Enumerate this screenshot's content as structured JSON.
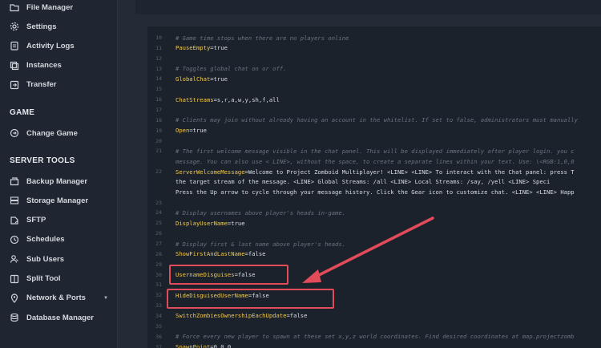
{
  "sidebar": {
    "items_top": [
      {
        "label": "File Manager",
        "icon": "folder-icon"
      },
      {
        "label": "Settings",
        "icon": "gear-icon"
      },
      {
        "label": "Activity Logs",
        "icon": "clipboard-icon"
      },
      {
        "label": "Instances",
        "icon": "layers-icon"
      },
      {
        "label": "Transfer",
        "icon": "transfer-icon"
      }
    ],
    "game_section": "GAME",
    "game_items": [
      {
        "label": "Change Game",
        "icon": "swap-icon"
      }
    ],
    "server_tools_section": "SERVER TOOLS",
    "server_items": [
      {
        "label": "Backup Manager",
        "icon": "backup-icon"
      },
      {
        "label": "Storage Manager",
        "icon": "storage-icon"
      },
      {
        "label": "SFTP",
        "icon": "sftp-icon"
      },
      {
        "label": "Schedules",
        "icon": "clock-icon"
      },
      {
        "label": "Sub Users",
        "icon": "users-icon"
      },
      {
        "label": "Split Tool",
        "icon": "split-icon"
      },
      {
        "label": "Network & Ports",
        "icon": "location-icon"
      },
      {
        "label": "Database Manager",
        "icon": "database-icon"
      }
    ]
  },
  "editor": {
    "lines": [
      {
        "n": "10",
        "type": "comment",
        "text": "# Game time stops when there are no players online"
      },
      {
        "n": "11",
        "type": "kv",
        "key": "PauseEmpty",
        "value": "=true"
      },
      {
        "n": "12",
        "type": "blank"
      },
      {
        "n": "13",
        "type": "comment",
        "text": "# Toggles global chat on or off."
      },
      {
        "n": "14",
        "type": "kv",
        "key": "GlobalChat",
        "value": "=true"
      },
      {
        "n": "15",
        "type": "blank"
      },
      {
        "n": "16",
        "type": "kv",
        "key": "ChatStreams",
        "value": "=s,r,a,w,y,sh,f,all"
      },
      {
        "n": "17",
        "type": "blank"
      },
      {
        "n": "18",
        "type": "comment",
        "text": "# Clients may join without already having an account in the whitelist. If set to false, administrators must manually"
      },
      {
        "n": "19",
        "type": "kv",
        "key": "Open",
        "value": "=true"
      },
      {
        "n": "20",
        "type": "blank"
      },
      {
        "n": "21",
        "type": "comment",
        "text": "# The first welcome message visible in the chat panel. This will be displayed immediately after player login. you c"
      },
      {
        "n": "",
        "type": "comment",
        "text": "message. You can also use < LINE>, without the space, to create a separate lines within your text. Use: \\<RGB:1,0,0"
      },
      {
        "n": "22",
        "type": "kv",
        "key": "ServerWelcomeMessage",
        "value": "=Welcome to Project Zomboid Multiplayer! <LINE> <LINE> To interact with the Chat panel: press T"
      },
      {
        "n": "",
        "type": "plain",
        "text": "the target stream of the message. <LINE> Global Streams: /all <LINE> Local Streams: /say, /yell <LINE> Speci"
      },
      {
        "n": "",
        "type": "plain",
        "text": "Press the Up arrow to cycle through your message history. Click the Gear icon to customize chat. <LINE> <LINE> Happ"
      },
      {
        "n": "23",
        "type": "blank"
      },
      {
        "n": "24",
        "type": "comment",
        "text": "# Display usernames above player's heads in-game."
      },
      {
        "n": "25",
        "type": "kv",
        "key": "DisplayUserName",
        "value": "=true"
      },
      {
        "n": "26",
        "type": "blank"
      },
      {
        "n": "27",
        "type": "comment",
        "text": "# Display first & last name above player's heads."
      },
      {
        "n": "28",
        "type": "kv",
        "key": "ShowFirstAndLastName",
        "value": "=false"
      },
      {
        "n": "29",
        "type": "blank"
      },
      {
        "n": "30",
        "type": "kv",
        "key": "UsernameDisguises",
        "value": "=false"
      },
      {
        "n": "31",
        "type": "blank"
      },
      {
        "n": "32",
        "type": "kv",
        "key": "HideDisguisedUserName",
        "value": "=false"
      },
      {
        "n": "33",
        "type": "blank"
      },
      {
        "n": "34",
        "type": "kv",
        "key": "SwitchZombiesOwnershipEachUpdate",
        "value": "=false"
      },
      {
        "n": "35",
        "type": "blank"
      },
      {
        "n": "36",
        "type": "comment",
        "text": "# Force every new player to spawn at these set x,y,z world coordinates. Find desired coordinates at map.projectzomb"
      },
      {
        "n": "37",
        "type": "kv",
        "key": "SpawnPoint",
        "value": "=0,0,0"
      }
    ]
  },
  "colors": {
    "highlight": "#e14b5a",
    "key": "#f2c94c",
    "comment": "#6b737f"
  }
}
